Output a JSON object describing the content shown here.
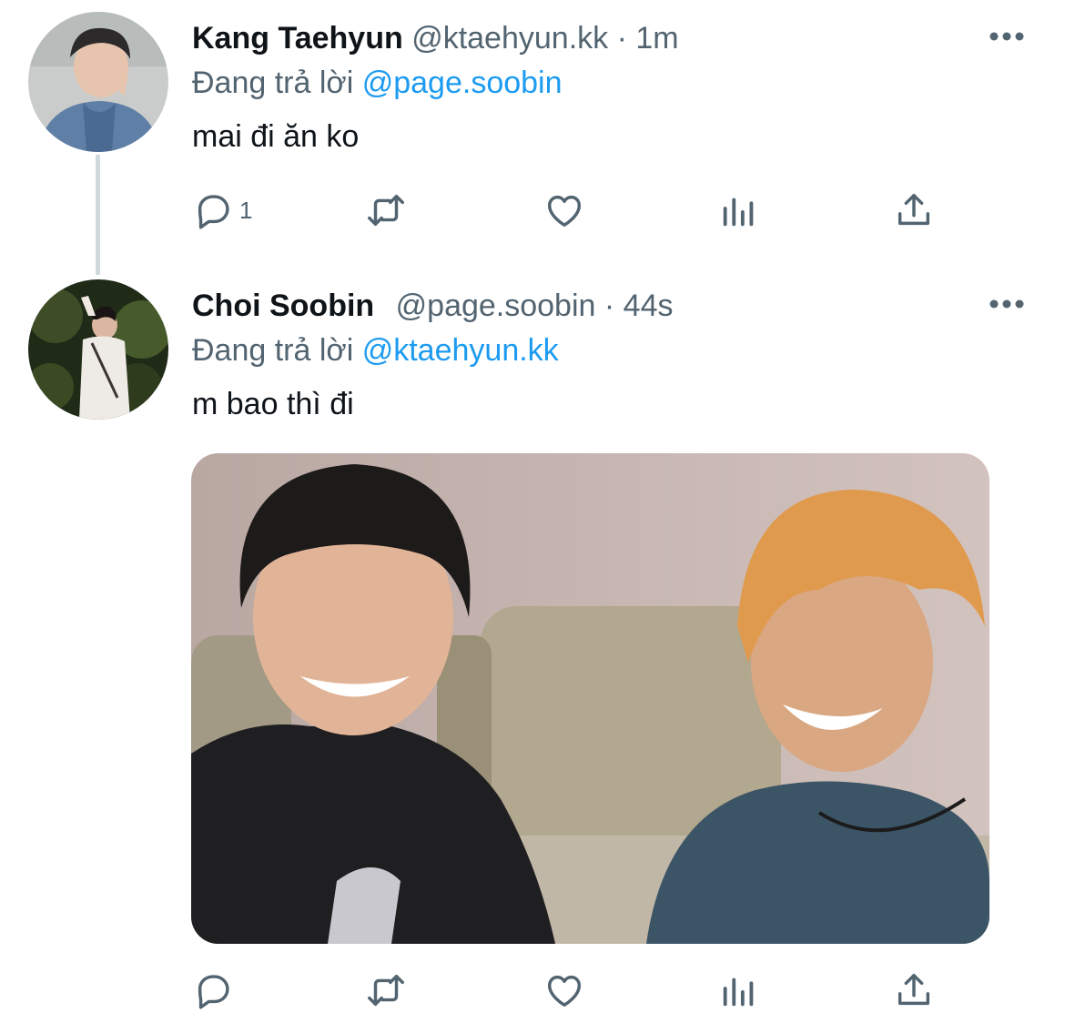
{
  "tweets": [
    {
      "name": "Kang Taehyun",
      "handle": "@ktaehyun.kk",
      "separator": "·",
      "time": "1m",
      "reply_prefix": "Đang trả lời",
      "reply_to": "@page.soobin",
      "text": "mai đi ăn ko",
      "reply_count": "1",
      "avatar_icon": "avatar-photo"
    },
    {
      "name": "Choi Soobin",
      "handle": "@page.soobin",
      "separator": "·",
      "time": "44s",
      "reply_prefix": "Đang trả lời",
      "reply_to": "@ktaehyun.kk",
      "text": "m bao thì đi",
      "reply_count": "",
      "avatar_icon": "avatar-photo",
      "media": "photo-two-people-smiling"
    }
  ],
  "icons": [
    "reply-icon",
    "retweet-icon",
    "like-icon",
    "analytics-icon",
    "share-icon",
    "more-icon"
  ],
  "colors": {
    "text": "#0f1419",
    "secondary": "#536471",
    "link": "#1d9bf0",
    "line": "#cfd9de"
  }
}
